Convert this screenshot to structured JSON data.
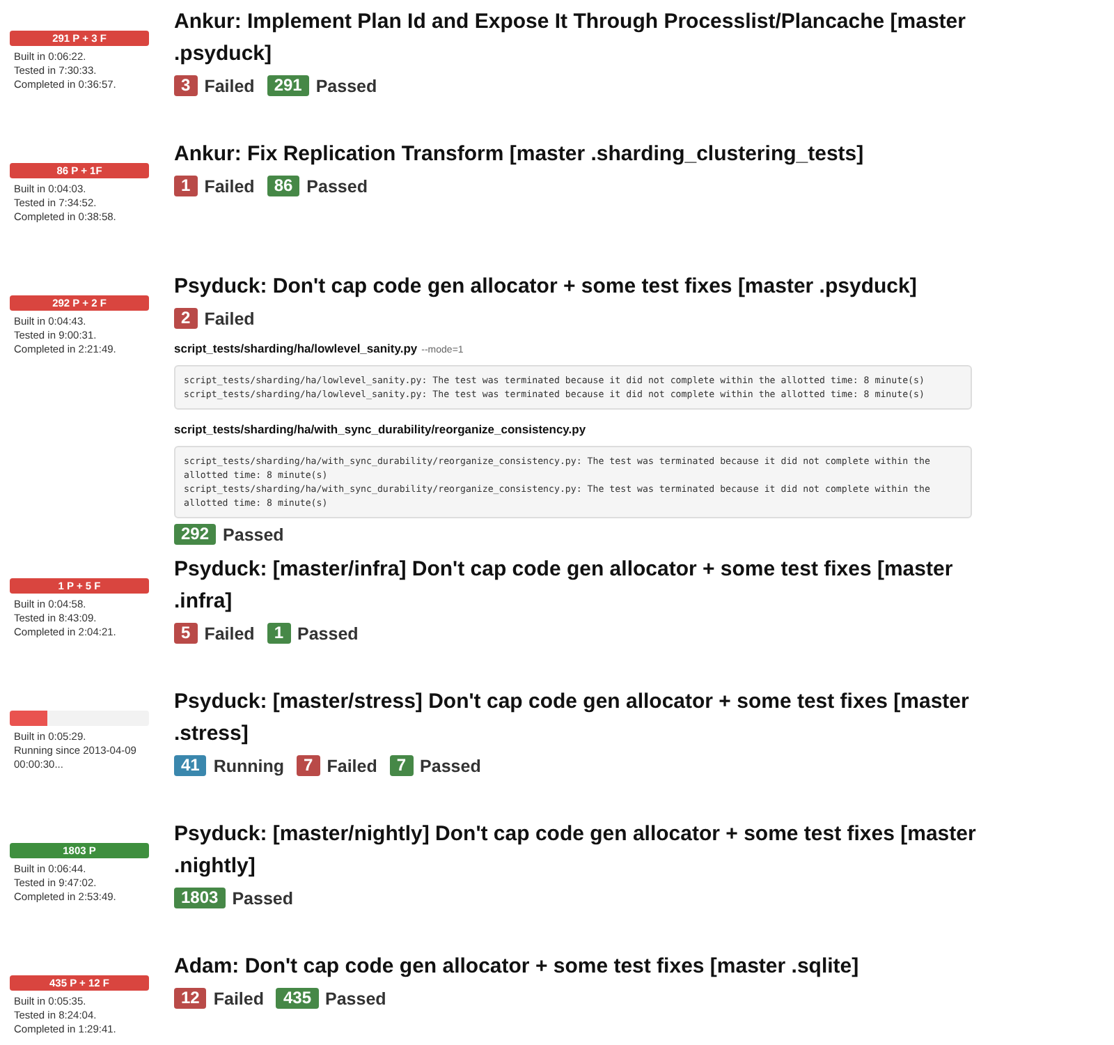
{
  "builds": [
    {
      "status": {
        "kind": "result",
        "color": "#d9453f",
        "label": "291 P + 3 F"
      },
      "info": [
        "Built in 0:06:22.",
        "Tested in 7:30:33.",
        "Completed in 0:36:57."
      ],
      "title": "Ankur: Implement Plan Id and Expose It Through Processlist/Plancache [master .psyduck]",
      "sections": [
        {
          "kind": "counts",
          "counts": [
            {
              "kind": "failed",
              "count": "3",
              "label": "Failed"
            },
            {
              "kind": "passed",
              "count": "291",
              "label": "Passed"
            }
          ]
        }
      ]
    },
    {
      "status": {
        "kind": "result",
        "color": "#d9453f",
        "label": "86 P + 1F"
      },
      "info": [
        "Built in 0:04:03.",
        "Tested in 7:34:52.",
        "Completed in 0:38:58."
      ],
      "title": "Ankur: Fix Replication Transform [master .sharding_clustering_tests]",
      "sections": [
        {
          "kind": "counts",
          "counts": [
            {
              "kind": "failed",
              "count": "1",
              "label": "Failed"
            },
            {
              "kind": "passed",
              "count": "86",
              "label": "Passed"
            }
          ]
        }
      ]
    },
    {
      "status": {
        "kind": "result",
        "color": "#d9453f",
        "label": "292 P + 2 F"
      },
      "info": [
        "Built in 0:04:43.",
        "Tested in 9:00:31.",
        "Completed in 2:21:49."
      ],
      "title": "Psyduck: Don't cap code gen allocator + some test fixes [master .psyduck]",
      "sections": [
        {
          "kind": "counts",
          "counts": [
            {
              "kind": "failed",
              "count": "2",
              "label": "Failed"
            }
          ]
        },
        {
          "kind": "failure",
          "file": "script_tests/sharding/ha/lowlevel_sanity.py",
          "args": "--mode=1",
          "log": [
            "script_tests/sharding/ha/lowlevel_sanity.py: The test was terminated because it did not complete within the allotted time: 8 minute(s)",
            "script_tests/sharding/ha/lowlevel_sanity.py: The test was terminated because it did not complete within the allotted time: 8 minute(s)"
          ]
        },
        {
          "kind": "failure",
          "file": "script_tests/sharding/ha/with_sync_durability/reorganize_consistency.py",
          "log": [
            "script_tests/sharding/ha/with_sync_durability/reorganize_consistency.py: The test was terminated because it did not complete within the allotted time: 8 minute(s)",
            "script_tests/sharding/ha/with_sync_durability/reorganize_consistency.py: The test was terminated because it did not complete within the allotted time: 8 minute(s)"
          ]
        },
        {
          "kind": "counts",
          "counts": [
            {
              "kind": "passed",
              "count": "292",
              "label": "Passed"
            }
          ]
        }
      ]
    },
    {
      "status": {
        "kind": "result",
        "color": "#d9453f",
        "label": "1 P + 5 F"
      },
      "info": [
        "Built in 0:04:58.",
        "Tested in 8:43:09.",
        "Completed in 2:04:21."
      ],
      "title": "Psyduck: [master/infra] Don't cap code gen allocator + some test fixes [master .infra]",
      "sections": [
        {
          "kind": "counts",
          "counts": [
            {
              "kind": "failed",
              "count": "5",
              "label": "Failed"
            },
            {
              "kind": "passed",
              "count": "1",
              "label": "Passed"
            }
          ]
        }
      ]
    },
    {
      "status": {
        "kind": "running",
        "color": "#e9534f",
        "level": 0.27
      },
      "info": [
        "Built in 0:05:29.",
        "Running since 2013-04-09 00:00:30..."
      ],
      "title": "Psyduck: [master/stress] Don't cap code gen allocator + some test fixes [master .stress]",
      "sections": [
        {
          "kind": "counts",
          "counts": [
            {
              "kind": "running",
              "count": "41",
              "label": "Running"
            },
            {
              "kind": "failed",
              "count": "7",
              "label": "Failed"
            },
            {
              "kind": "passed",
              "count": "7",
              "label": "Passed"
            }
          ]
        }
      ]
    },
    {
      "status": {
        "kind": "result",
        "color": "#3e8f3e",
        "label": "1803 P"
      },
      "info": [
        "Built in 0:06:44.",
        "Tested in 9:47:02.",
        "Completed in 2:53:49."
      ],
      "title": "Psyduck: [master/nightly] Don't cap code gen allocator + some test fixes [master .nightly]",
      "sections": [
        {
          "kind": "counts",
          "counts": [
            {
              "kind": "passed",
              "count": "1803",
              "label": "Passed"
            }
          ]
        }
      ]
    },
    {
      "status": {
        "kind": "result",
        "color": "#d9453f",
        "label": "435 P + 12 F"
      },
      "info": [
        "Built in 0:05:35.",
        "Tested in 8:24:04.",
        "Completed in 1:29:41."
      ],
      "title": "Adam: Don't cap code gen allocator + some test fixes [master .sqlite]",
      "sections": [
        {
          "kind": "counts",
          "counts": [
            {
              "kind": "failed",
              "count": "12",
              "label": "Failed"
            },
            {
              "kind": "passed",
              "count": "435",
              "label": "Passed"
            }
          ]
        }
      ]
    }
  ]
}
